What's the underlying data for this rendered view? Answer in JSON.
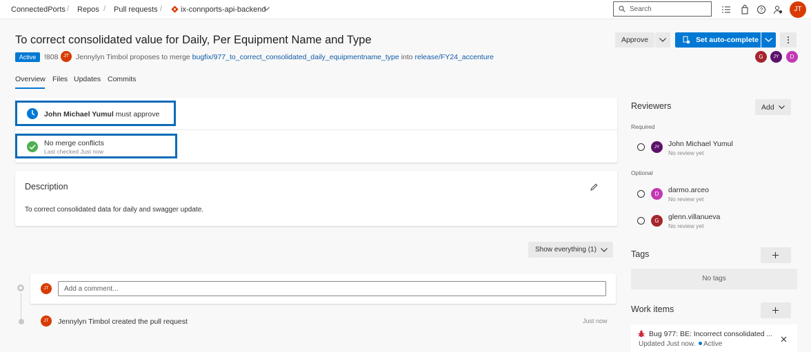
{
  "breadcrumb": {
    "org": "ConnectedPorts",
    "repos": "Repos",
    "pull_requests": "Pull requests",
    "repo_name": "ix-connports-api-backend"
  },
  "search": {
    "placeholder": "Search"
  },
  "user": {
    "initials": "JT",
    "color": "#d83b01"
  },
  "pr": {
    "title": "To correct consolidated value for Daily, Per Equipment Name and Type",
    "status": "Active",
    "id": "!808",
    "author_initials": "JT",
    "proposes_text": "Jennylyn Timbol proposes to merge",
    "source_branch": "bugfix/977_to_correct_consolidated_daily_equipmentname_type",
    "into_text": "into",
    "target_branch": "release/FY24_accenture"
  },
  "actions": {
    "approve_label": "Approve",
    "autocomplete_label": "Set auto-complete"
  },
  "header_avatars": [
    {
      "initials": "G",
      "color": "#a4262c"
    },
    {
      "initials": "JY",
      "color": "#5c126b"
    },
    {
      "initials": "D",
      "color": "#c239b3"
    }
  ],
  "tabs": [
    {
      "label": "Overview"
    },
    {
      "label": "Files"
    },
    {
      "label": "Updates"
    },
    {
      "label": "Commits"
    }
  ],
  "status_items": {
    "approve_name": "John Michael Yumul",
    "approve_suffix": " must approve",
    "merge_title": "No merge conflicts",
    "merge_sub": "Last checked Just now"
  },
  "description": {
    "heading": "Description",
    "text": "To correct consolidated data for daily and swagger update."
  },
  "filter": {
    "label": "Show everything (1)"
  },
  "comment": {
    "avatar": "JT",
    "placeholder": "Add a comment..."
  },
  "activity": {
    "avatar": "JT",
    "text": "Jennylyn Timbol created the pull request",
    "time": "Just now"
  },
  "reviewers": {
    "heading": "Reviewers",
    "add_label": "Add",
    "required_label": "Required",
    "optional_label": "Optional",
    "required": [
      {
        "name": "John Michael Yumul",
        "status": "No review yet",
        "initials": "JY",
        "color": "#5c126b"
      }
    ],
    "optional": [
      {
        "name": "darmo.arceo",
        "status": "No review yet",
        "initials": "D",
        "color": "#c239b3"
      },
      {
        "name": "glenn.villanueva",
        "status": "No review yet",
        "initials": "G",
        "color": "#a4262c"
      }
    ]
  },
  "tags": {
    "heading": "Tags",
    "empty": "No tags"
  },
  "work_items": {
    "heading": "Work items",
    "item_title": "Bug 977: BE: Incorrect consolidated ...",
    "item_updated": "Updated Just now.",
    "item_state": "Active"
  },
  "colors": {
    "accent": "#0078d4",
    "highlight": "#0a6bb8",
    "success": "#4caf50",
    "status_blue": "#0078d4"
  }
}
